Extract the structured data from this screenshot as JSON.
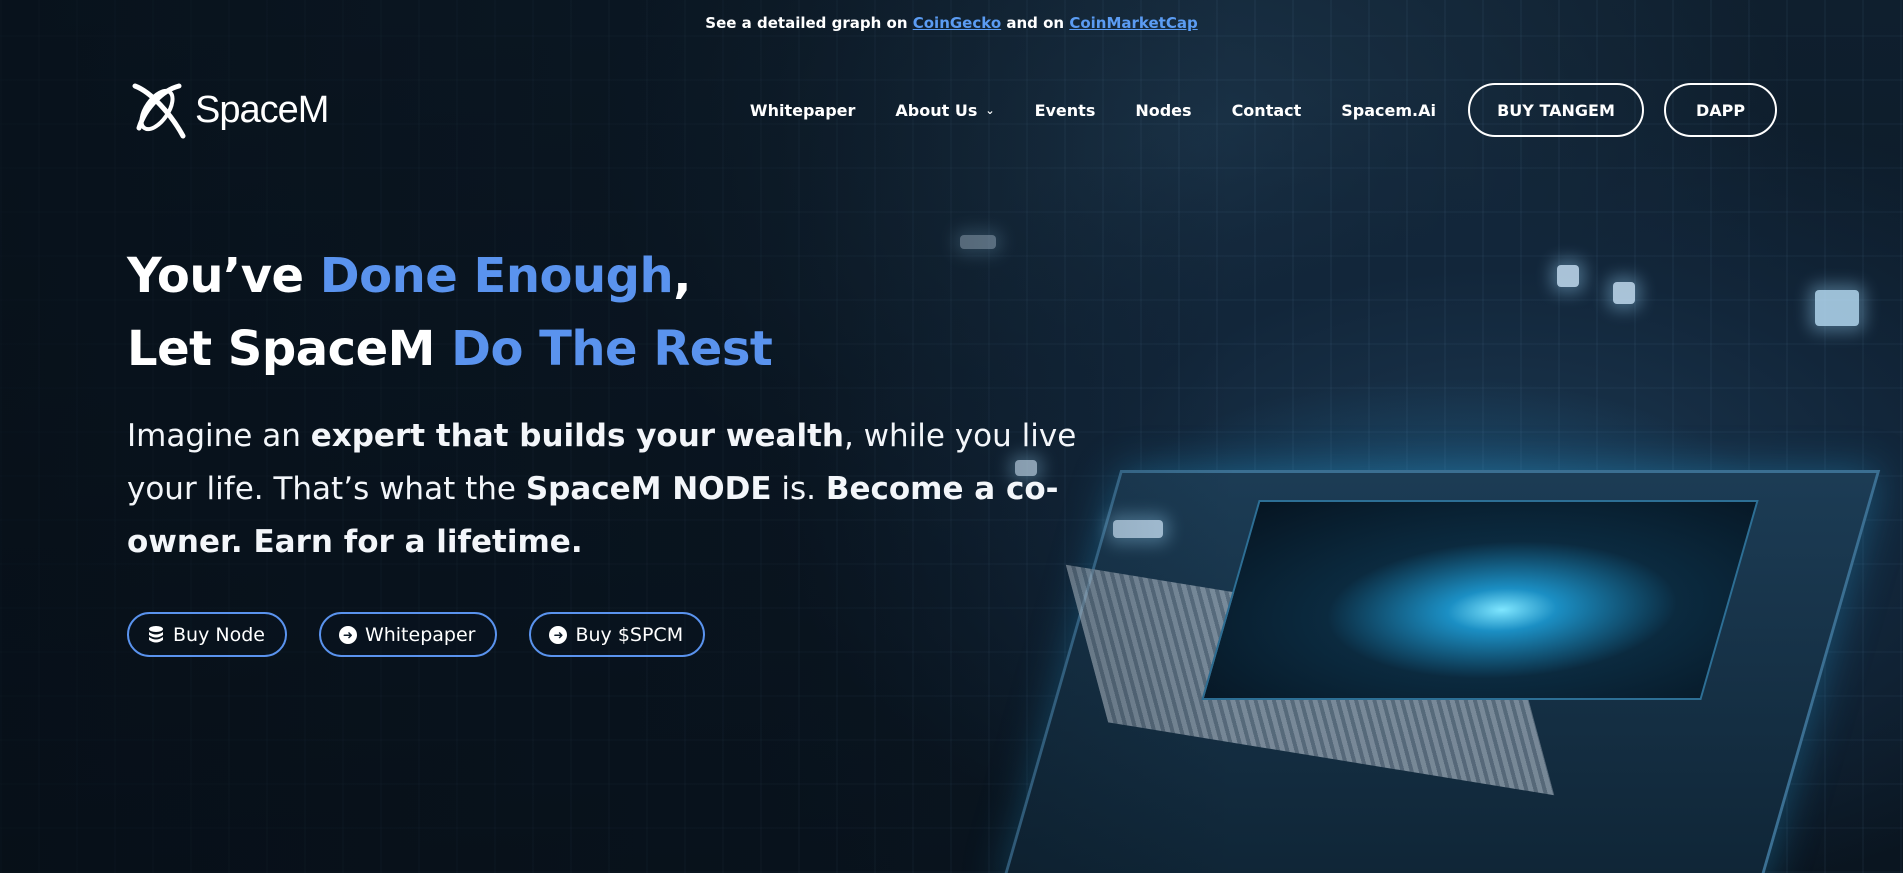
{
  "notice": {
    "prefix": "See a detailed graph on ",
    "link1": "CoinGecko",
    "middle": " and on ",
    "link2": "CoinMarketCap"
  },
  "header": {
    "logo_text": "SpaceM",
    "nav": {
      "whitepaper": "Whitepaper",
      "about": "About Us",
      "events": "Events",
      "nodes": "Nodes",
      "contact": "Contact",
      "spacem_ai": "Spacem.Ai"
    },
    "buy_tangem": "BUY TANGEM",
    "dapp": "DAPP"
  },
  "hero": {
    "line1_white": "You’ve ",
    "line1_accent": "Done Enough",
    "line1_tail": ",",
    "line2_white": "Let SpaceM ",
    "line2_accent": "Do The Rest",
    "lede": {
      "t1": "Imagine an ",
      "b1": "expert that builds your wealth",
      "t2": ", while you live your life. That’s what the ",
      "b2": "SpaceM NODE",
      "t3": " is. ",
      "b3": "Become a co-owner. Earn for a lifetime."
    },
    "cta": {
      "buy_node": "Buy Node",
      "whitepaper": "Whitepaper",
      "buy_spcm": "Buy $SPCM"
    }
  },
  "colors": {
    "accent": "#5a93ee",
    "link": "#5b9cf3",
    "background": "#0a1622",
    "text": "#ffffff"
  },
  "icons": {
    "chevron": "chevron-down-icon",
    "coins": "coins-icon",
    "arrow": "arrow-circle-right-icon"
  }
}
